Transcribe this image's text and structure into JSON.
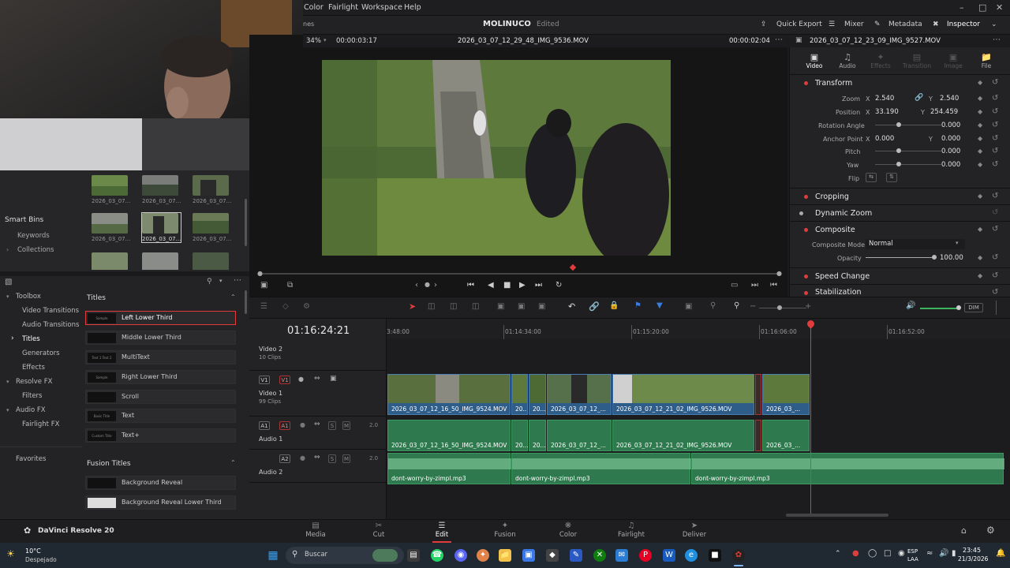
{
  "menu": {
    "items": [
      "Color",
      "Fairlight",
      "Workspace",
      "Help"
    ]
  },
  "titlebar": {
    "project": "MOLINUCO",
    "status": "Edited",
    "quick_export": "Quick Export",
    "mixer": "Mixer",
    "metadata": "Metadata",
    "inspector": "Inspector"
  },
  "viewer": {
    "zoom": "34%",
    "timecode_left": "00:00:03:17",
    "clip_name": "2026_03_07_12_29_48_IMG_9536.MOV",
    "timecode_right": "00:00:02:04",
    "inspector_clip": "2026_03_07_12_23_09_IMG_9527.MOV",
    "partial_label": "nes"
  },
  "mediapool": {
    "thumbs": [
      {
        "label": "2026_03_07..."
      },
      {
        "label": "2026_03_07..."
      },
      {
        "label": "2026_03_07..."
      },
      {
        "label": "2026_03_07..."
      },
      {
        "label": "2026_03_07..."
      },
      {
        "label": "2026_03_07..."
      }
    ],
    "smart_bins": "Smart Bins",
    "keywords": "Keywords",
    "collections": "Collections"
  },
  "inspector": {
    "tabs": [
      "Video",
      "Audio",
      "Effects",
      "Transition",
      "Image",
      "File"
    ],
    "transform": "Transform",
    "zoom_label": "Zoom",
    "zoom_x": "2.540",
    "zoom_y": "2.540",
    "position_label": "Position",
    "pos_x": "33.190",
    "pos_y": "254.459",
    "rotation_label": "Rotation Angle",
    "rotation": "0.000",
    "anchor_label": "Anchor Point",
    "anchor_x": "0.000",
    "anchor_y": "0.000",
    "pitch_label": "Pitch",
    "pitch": "0.000",
    "yaw_label": "Yaw",
    "yaw": "0.000",
    "flip_label": "Flip",
    "x": "X",
    "y": "Y",
    "cropping": "Cropping",
    "dynamic_zoom": "Dynamic Zoom",
    "composite": "Composite",
    "composite_mode_label": "Composite Mode",
    "composite_mode": "Normal",
    "opacity_label": "Opacity",
    "opacity": "100.00",
    "speed_change": "Speed Change",
    "stabilization": "Stabilization"
  },
  "effects": {
    "toolbox": "Toolbox",
    "video_transitions": "Video Transitions",
    "audio_transitions": "Audio Transitions",
    "titles": "Titles",
    "generators": "Generators",
    "effects": "Effects",
    "resolve_fx": "Resolve FX",
    "filters": "Filters",
    "audio_fx": "Audio FX",
    "fairlight_fx": "Fairlight FX",
    "favorites": "Favorites",
    "titles_header": "Titles",
    "title_items": [
      "Left Lower Third",
      "Middle Lower Third",
      "MultiText",
      "Right Lower Third",
      "Scroll",
      "Text",
      "Text+"
    ],
    "thumb_texts": [
      "Sample",
      "",
      "Text 1 Text 2",
      "Sample",
      "",
      "Basic Title",
      "Custom Title"
    ],
    "fusion_header": "Fusion Titles",
    "fusion_items": [
      "Background Reveal",
      "Background Reveal Lower Third"
    ]
  },
  "timeline": {
    "timecode": "01:16:24:21",
    "ruler": [
      "3:48:00",
      "01:14:34:00",
      "01:15:20:00",
      "01:16:06:00",
      "01:16:52:00"
    ],
    "tracks": {
      "v2": {
        "name": "Video 2",
        "sub": "10 Clips"
      },
      "v1": {
        "name": "Video 1",
        "sub": "99 Clips",
        "tag": "V1"
      },
      "a1": {
        "name": "Audio 1",
        "tag": "A1",
        "level": "2.0"
      },
      "a2": {
        "name": "Audio 2",
        "tag": "A2",
        "level": "2.0"
      }
    },
    "video_clips": [
      "2026_03_07_12_16_50_IMG_9524.MOV",
      "20...",
      "20...",
      "2026_03_07_12_...",
      "2026_03_07_12_21_02_IMG_9526.MOV",
      "2026_03_..."
    ],
    "audio_clips": [
      "2026_03_07_12_16_50_IMG_9524.MOV",
      "20...",
      "20...",
      "2026_03_07_12_...",
      "2026_03_07_12_21_02_IMG_9526.MOV",
      "2026_03_..."
    ],
    "music_clips": [
      "dont-worry-by-zimpl.mp3",
      "dont-worry-by-zimpl.mp3",
      "dont-worry-by-zimpl.mp3"
    ],
    "dim": "DIM",
    "s": "S",
    "m": "M"
  },
  "pagebar": {
    "app": "DaVinci Resolve 20",
    "pages": [
      "Media",
      "Cut",
      "Edit",
      "Fusion",
      "Color",
      "Fairlight",
      "Deliver"
    ],
    "active": "Edit"
  },
  "taskbar": {
    "weather_temp": "10°C",
    "weather_desc": "Despejado",
    "search": "Buscar",
    "lang1": "ESP",
    "lang2": "LAA",
    "time": "23:45",
    "date": "21/3/2026"
  },
  "colors": {
    "accent_red": "#e03c3c",
    "video_clip": "#2e5d8a",
    "audio_clip": "#2e7a4e",
    "playhead": "#e03c3c"
  }
}
